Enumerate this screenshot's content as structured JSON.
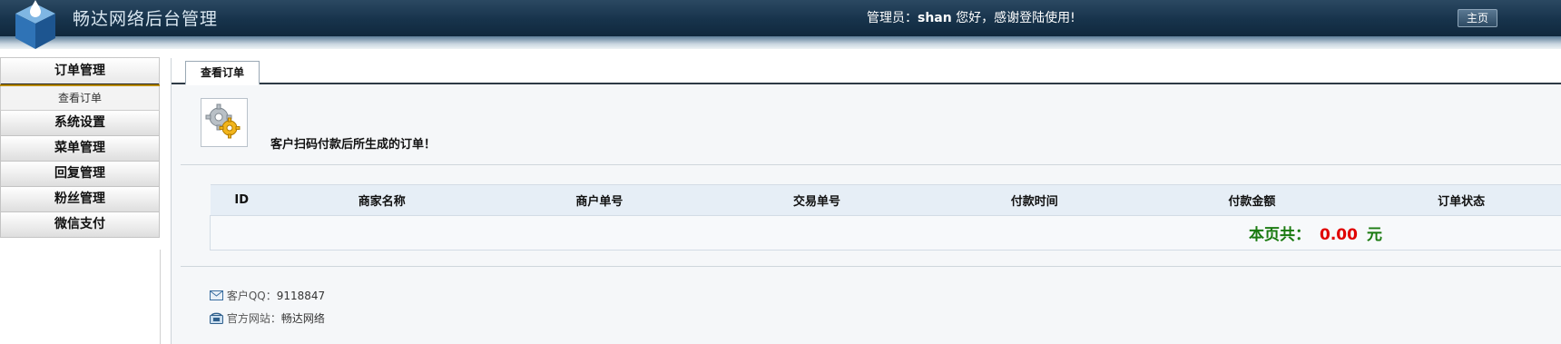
{
  "header": {
    "app_title": "畅达网络后台管理",
    "welcome_prefix": "管理员：",
    "admin_name": "shan",
    "welcome_suffix": " 您好，感谢登陆使用!",
    "home_button": "主页"
  },
  "sidebar": {
    "group_title": "订单管理",
    "sub_items": [
      "查看订单"
    ],
    "items": [
      "系统设置",
      "菜单管理",
      "回复管理",
      "粉丝管理",
      "微信支付"
    ]
  },
  "main": {
    "tab": "查看订单",
    "intro": "客户扫码付款后所生成的订单！",
    "table": {
      "columns": [
        "ID",
        "商家名称",
        "商户单号",
        "交易单号",
        "付款时间",
        "付款金额",
        "订单状态"
      ],
      "total_label": "本页共：",
      "total_value": "0.00",
      "total_unit": "元"
    },
    "footer": {
      "qq_label": "客户QQ：",
      "qq_value": "9118847",
      "site_label": "官方网站：",
      "site_value": "畅达网络"
    }
  },
  "colors": {
    "header_bg": "#17334b",
    "total_green": "#1a7a10",
    "total_red": "#e00000"
  },
  "icons": [
    "cube-logo-icon",
    "gear-icon",
    "mail-icon",
    "phone-icon"
  ]
}
